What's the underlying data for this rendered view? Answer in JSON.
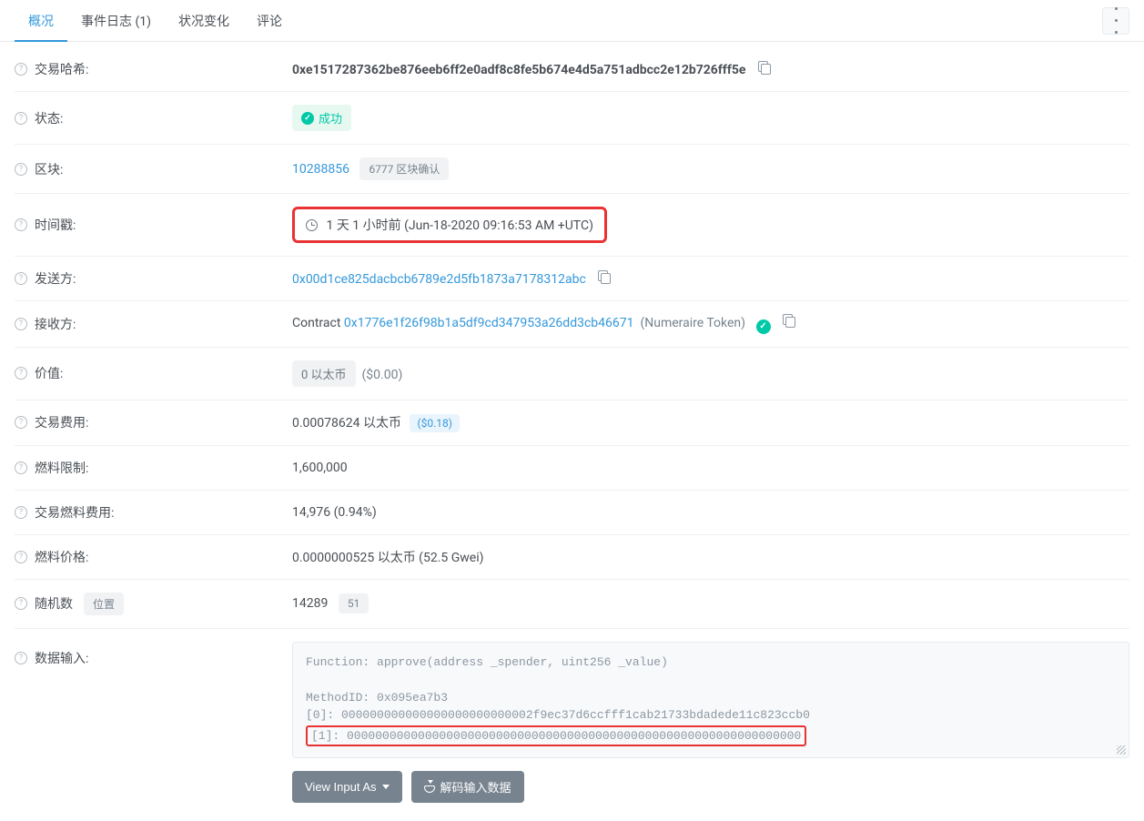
{
  "tabs": {
    "overview": "概况",
    "events": "事件日志 (1)",
    "state": "状况变化",
    "comments": "评论"
  },
  "labels": {
    "txhash": "交易哈希:",
    "status": "状态:",
    "block": "区块:",
    "timestamp": "时间戳:",
    "from": "发送方:",
    "to": "接收方:",
    "value": "价值:",
    "txfee": "交易费用:",
    "gaslimit": "燃料限制:",
    "gasused": "交易燃料费用:",
    "gasprice": "燃料价格:",
    "nonce": "随机数",
    "nonce_pos": "位置",
    "inputdata": "数据输入:"
  },
  "values": {
    "txhash": "0xe1517287362be876eeb6ff2e0adf8c8fe5b674e4d5a751adbcc2e12b726fff5e",
    "status": "成功",
    "block": "10288856",
    "block_conf": "6777 区块确认",
    "timestamp": "1 天 1 小时前 (Jun-18-2020 09:16:53 AM +UTC)",
    "from": "0x00d1ce825dacbcb6789e2d5fb1873a7178312abc",
    "to_prefix": "Contract",
    "to": "0x1776e1f26f98b1a5df9cd347953a26dd3cb46671",
    "to_name": "(Numeraire Token)",
    "value": "0 以太币",
    "value_usd": "($0.00)",
    "txfee": "0.00078624 以太币",
    "txfee_usd": "($0.18)",
    "gaslimit": "1,600,000",
    "gasused": "14,976 (0.94%)",
    "gasprice": "0.0000000525 以太币 (52.5 Gwei)",
    "nonce": "14289",
    "nonce_pos": "51",
    "input_l1": "Function: approve(address _spender, uint256 _value)",
    "input_l2": "MethodID: 0x095ea7b3",
    "input_l3": "[0]:  000000000000000000000000002f9ec37d6ccfff1cab21733bdadede11c823ccb0",
    "input_l4": "[1]:  0000000000000000000000000000000000000000000000000000000000000000"
  },
  "buttons": {
    "view_input": "View Input As",
    "decode": "解码输入数据"
  }
}
